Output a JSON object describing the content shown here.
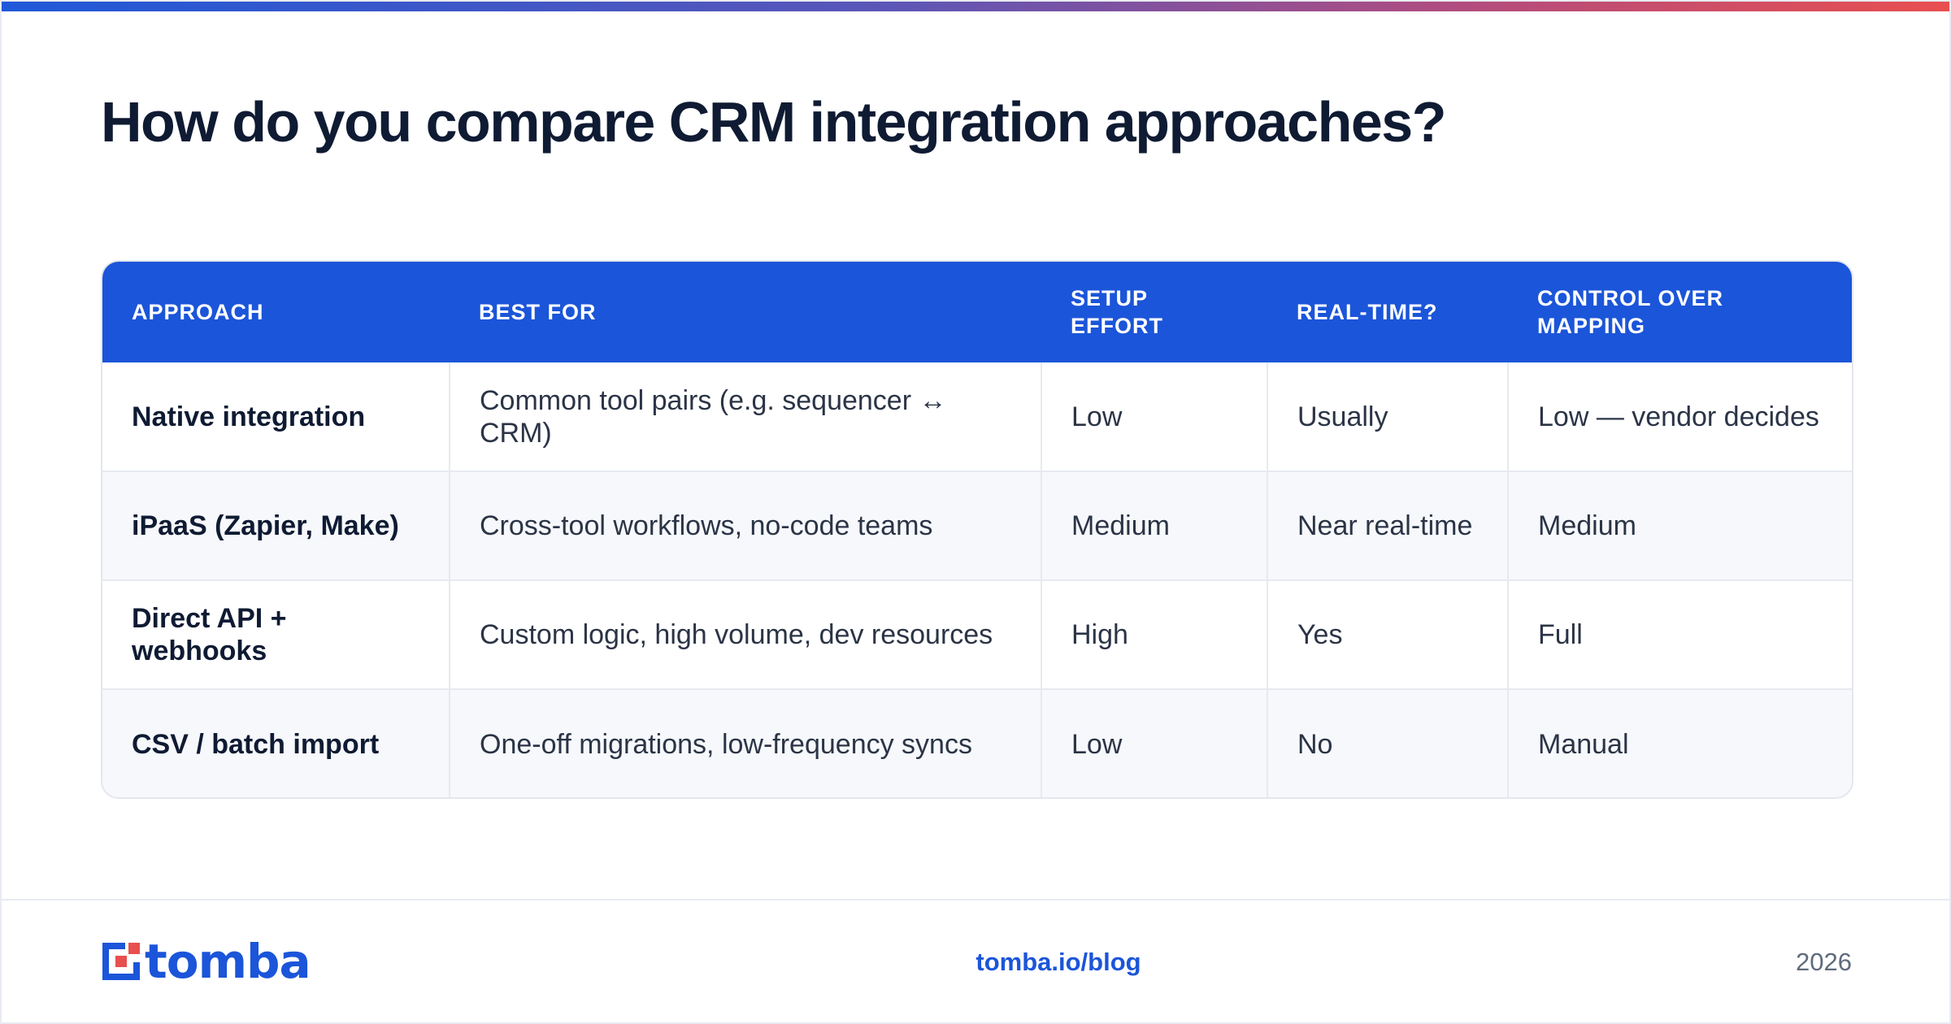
{
  "title": "How do you compare CRM integration approaches?",
  "table": {
    "headers": [
      "APPROACH",
      "BEST FOR",
      "SETUP EFFORT",
      "REAL-TIME?",
      "CONTROL OVER MAPPING"
    ],
    "rows": [
      [
        "Native integration",
        "Common tool pairs (e.g. sequencer ↔ CRM)",
        "Low",
        "Usually",
        "Low — vendor decides"
      ],
      [
        "iPaaS (Zapier, Make)",
        "Cross-tool workflows, no-code teams",
        "Medium",
        "Near real-time",
        "Medium"
      ],
      [
        "Direct API + webhooks",
        "Custom logic, high volume, dev resources",
        "High",
        "Yes",
        "Full"
      ],
      [
        "CSV / batch import",
        "One-off migrations, low-frequency syncs",
        "Low",
        "No",
        "Manual"
      ]
    ]
  },
  "footer": {
    "logo_text": "tomba",
    "link": "tomba.io/blog",
    "year": "2026"
  },
  "colors": {
    "accent": "#1b55d9",
    "header_bg": "#1b55d9",
    "title": "#0f1b33",
    "stripe": "#f6f8fb"
  },
  "icons": {
    "logo": "tomba-logo-icon"
  }
}
